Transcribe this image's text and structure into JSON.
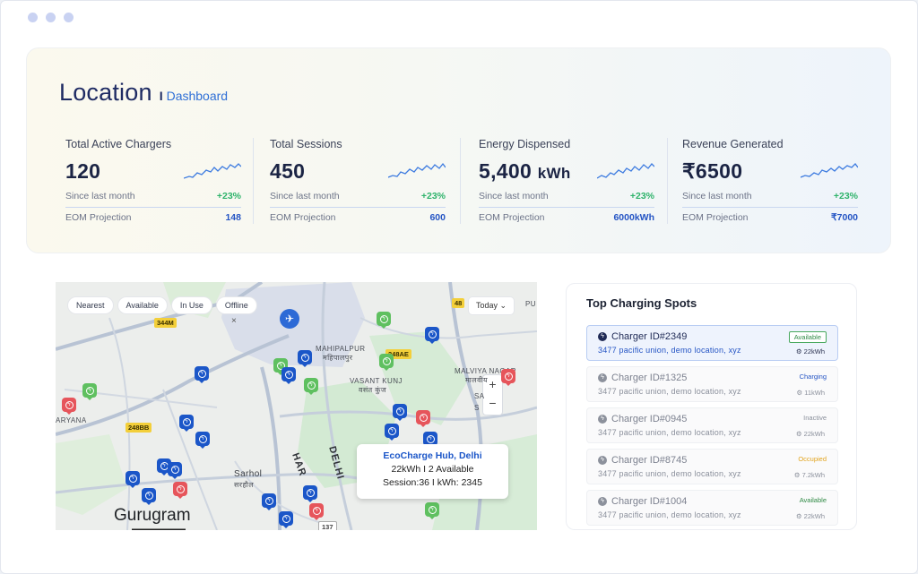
{
  "header": {
    "title": "Location",
    "separator": "I",
    "subtitle": "Dashboard"
  },
  "stats": [
    {
      "label": "Total Active Chargers",
      "value": "120",
      "unit": "",
      "since_label": "Since last month",
      "change": "+23%",
      "proj_label": "EOM Projection",
      "proj_value": "148"
    },
    {
      "label": "Total Sessions",
      "value": "450",
      "unit": "",
      "since_label": "Since last month",
      "change": "+23%",
      "proj_label": "EOM Projection",
      "proj_value": "600"
    },
    {
      "label": "Energy Dispensed",
      "value": "5,400",
      "unit": "kWh",
      "since_label": "Since last month",
      "change": "+23%",
      "proj_label": "EOM Projection",
      "proj_value": "6000kWh"
    },
    {
      "label": "Revenue Generated",
      "value": "₹6500",
      "unit": "",
      "since_label": "Since last month",
      "change": "+23%",
      "proj_label": "EOM Projection",
      "proj_value": "₹7000"
    }
  ],
  "map": {
    "filters": [
      "Nearest",
      "Available",
      "In Use",
      "Offline"
    ],
    "filter_close": "×",
    "period": "Today",
    "zoom_in": "+",
    "zoom_out": "−",
    "places": {
      "mahipalpur": "MAHIPALPUR",
      "mahipalpur_hi": "महिपालपुर",
      "vasant_kunj": "VASANT KUNJ",
      "vasant_kunj_hi": "वसंत कुंज",
      "malviya": "MALVIYA NAGAR",
      "malviya_hi": "मालवीय",
      "aryana": "ARYANA",
      "sarhol": "Sarhol",
      "sarhol_hi": "सरहौल",
      "gurugram": "Gurugram",
      "haryana_road": "HAR",
      "delhi_road": "DELHI",
      "pu": "PU",
      "sa": "SA",
      "sa2": "S"
    },
    "road_tags": {
      "t344m": "344M",
      "t48": "48",
      "t248ae": "248AE",
      "t248bb": "248BB",
      "t137": "137"
    },
    "tooltip": {
      "name": "EcoCharge Hub, Delhi",
      "line1": "22kWh I 2 Available",
      "line2": "Session:36 I kWh: 2345"
    },
    "pin_colors": {
      "available": "#5fc060",
      "in_use": "#1b56c8",
      "offline": "#e6555b"
    }
  },
  "spots": {
    "title": "Top Charging Spots",
    "items": [
      {
        "name": "Charger ID#2349",
        "address": "3477 pacific union, demo location, xyz",
        "status": "Available",
        "power": "22kWh",
        "status_color": "#2f8a45",
        "active": true
      },
      {
        "name": "Charger ID#1325",
        "address": "3477 pacific union, demo location, xyz",
        "status": "Charging",
        "power": "11kWh",
        "status_color": "#2454c4",
        "active": false
      },
      {
        "name": "Charger ID#0945",
        "address": "3477 pacific union, demo location, xyz",
        "status": "Inactive",
        "power": "22kWh",
        "status_color": "#8a8f9b",
        "active": false
      },
      {
        "name": "Charger ID#8745",
        "address": "3477 pacific union, demo location, xyz",
        "status": "Occupied",
        "power": "7.2kWh",
        "status_color": "#e2a41e",
        "active": false
      },
      {
        "name": "Charger ID#1004",
        "address": "3477 pacific union, demo location, xyz",
        "status": "Available",
        "power": "22kWh",
        "status_color": "#2f8a45",
        "active": false
      }
    ]
  }
}
